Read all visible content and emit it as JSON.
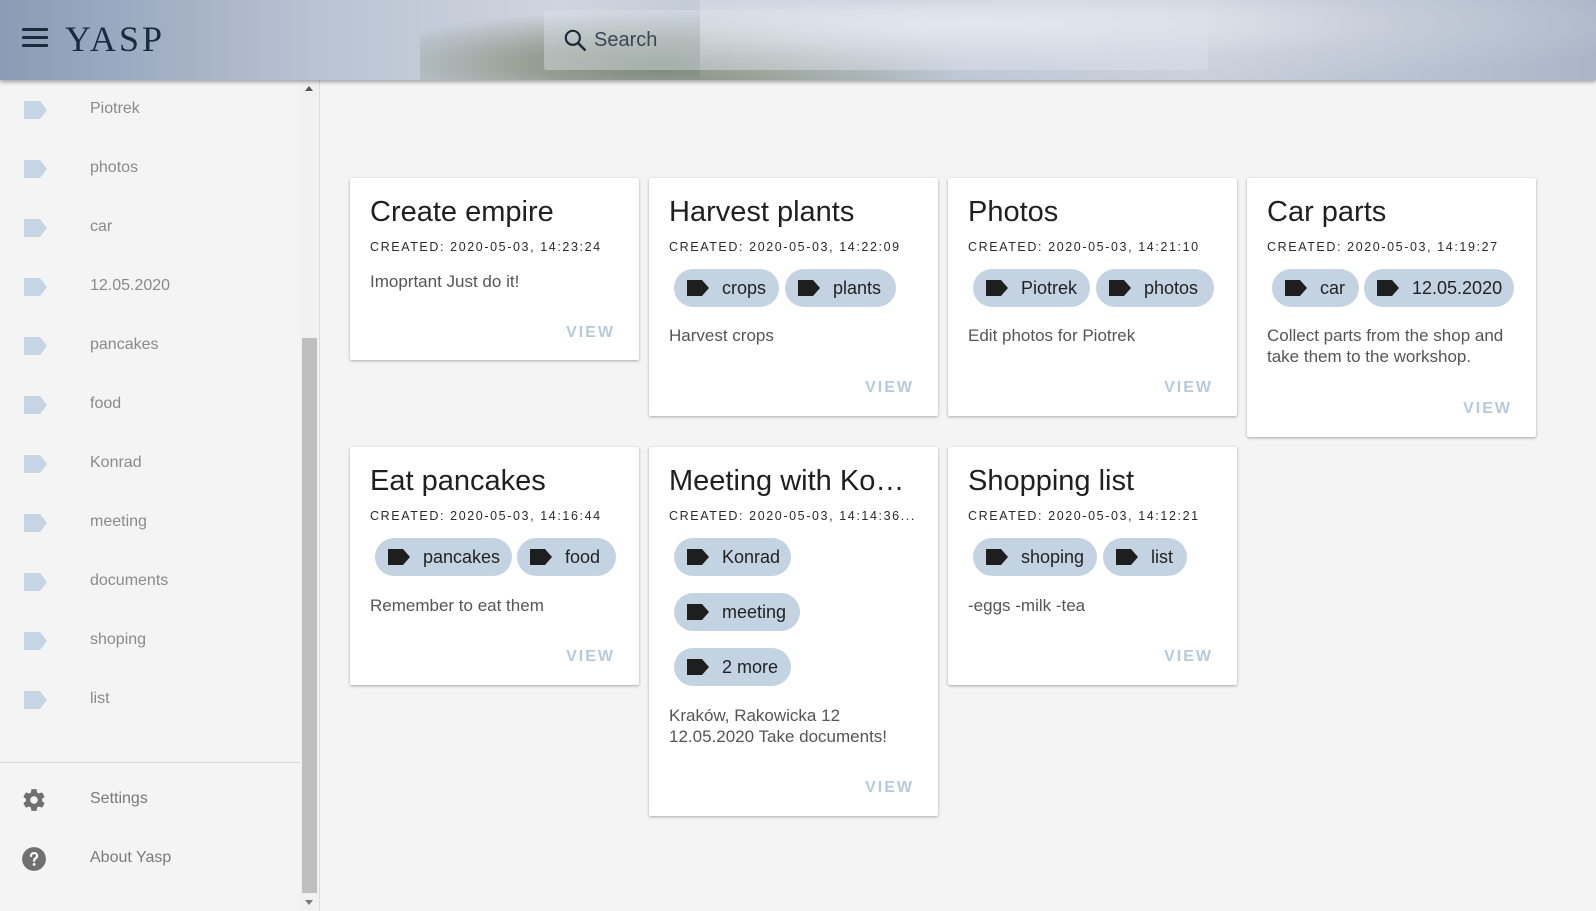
{
  "header": {
    "logo": "YASP",
    "search_placeholder": "Search"
  },
  "sidebar": {
    "tags": [
      "Piotrek",
      "photos",
      "car",
      "12.05.2020",
      "pancakes",
      "food",
      "Konrad",
      "meeting",
      "documents",
      "shoping",
      "list"
    ],
    "settings_label": "Settings",
    "about_label": "About Yasp"
  },
  "notes": [
    {
      "title": "Create empire",
      "created": "CREATED: 2020-05-03, 14:23:24",
      "tags": [],
      "body": "Imoprtant Just do it!",
      "view": "VIEW"
    },
    {
      "title": "Harvest plants",
      "created": "CREATED: 2020-05-03, 14:22:09",
      "tags": [
        "crops",
        "plants"
      ],
      "body": "Harvest crops",
      "view": "VIEW"
    },
    {
      "title": "Photos",
      "created": "CREATED: 2020-05-03, 14:21:10",
      "tags": [
        "Piotrek",
        "photos"
      ],
      "body": "Edit photos for Piotrek",
      "view": "VIEW"
    },
    {
      "title": "Car parts",
      "created": "CREATED: 2020-05-03, 14:19:27",
      "tags": [
        "car",
        "12.05.2020"
      ],
      "body": "Collect parts from the shop and take them to the workshop.",
      "view": "VIEW"
    },
    {
      "title": "Eat pancakes",
      "created": "CREATED: 2020-05-03, 14:16:44",
      "tags": [
        "pancakes",
        "food"
      ],
      "body": "Remember to eat them",
      "view": "VIEW"
    },
    {
      "title": "Meeting with Konrad",
      "created": "CREATED: 2020-05-03, 14:14:36...",
      "tags": [
        "Konrad",
        "meeting",
        "2 more"
      ],
      "body": "Kraków, Rakowicka 12 12.05.2020 Take documents!",
      "view": "VIEW"
    },
    {
      "title": "Shopping list",
      "created": "CREATED: 2020-05-03, 14:12:21",
      "tags": [
        "shoping",
        "list"
      ],
      "body": "-eggs -milk -tea",
      "view": "VIEW"
    }
  ],
  "colors": {
    "chip": "#c3d3e1",
    "view": "#b7cadb",
    "tag_icon": "#c5d5e4"
  }
}
